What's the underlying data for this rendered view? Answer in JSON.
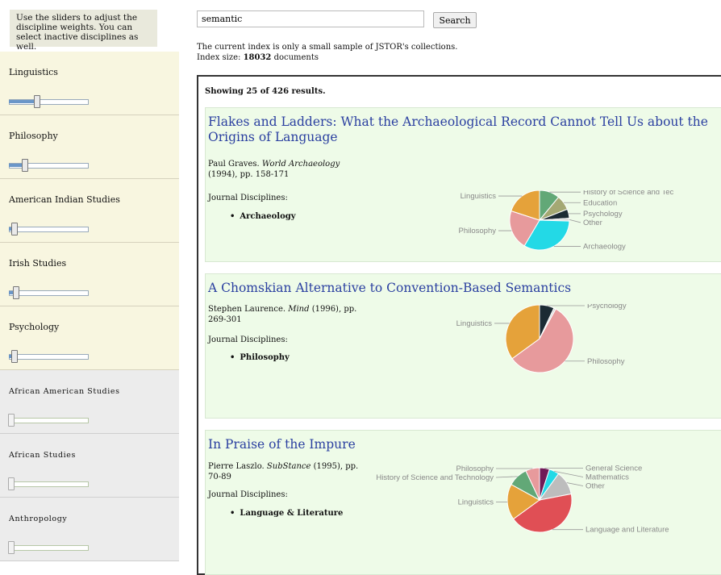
{
  "sidebar": {
    "instructions": "Use the sliders to adjust the discipline weights. You can select inactive disciplines as well.",
    "disciplines": [
      {
        "label": "Linguistics",
        "active": true,
        "weight": 0.35
      },
      {
        "label": "Philosophy",
        "active": true,
        "weight": 0.2
      },
      {
        "label": "American Indian Studies",
        "active": true,
        "weight": 0.06
      },
      {
        "label": "Irish Studies",
        "active": true,
        "weight": 0.08
      },
      {
        "label": "Psychology",
        "active": true,
        "weight": 0.06
      },
      {
        "label": "African American Studies",
        "active": false,
        "weight": 0.02
      },
      {
        "label": "African Studies",
        "active": false,
        "weight": 0.02
      },
      {
        "label": "Anthropology",
        "active": false,
        "weight": 0.02
      }
    ]
  },
  "search": {
    "value": "semantic",
    "button_label": "Search"
  },
  "notice": {
    "line1": "The current index is only a small sample of JSTOR's collections.",
    "index_prefix": "Index size: ",
    "index_size": "18032",
    "index_suffix": " documents"
  },
  "results": {
    "count_text": "Showing 25 of 426 results.",
    "discipline_header": "Journal Disciplines:",
    "colors": {
      "orange": "#e5a23a",
      "pink": "#e79a9c",
      "cyan": "#23d9e6",
      "dark": "#1c2b34",
      "olive": "#a4a873",
      "green": "#62a877",
      "light": "#d8d8d8",
      "red": "#e04f55",
      "grey": "#bdbdbd",
      "purple": "#701c57"
    },
    "items": [
      {
        "title": "Flakes and Ladders: What the Archaeological Record Cannot Tell Us about the Origins of Language",
        "author": "Paul Graves.",
        "journal": "World Archaeology",
        "citation": "(1994), pp. 158-171",
        "discipline": "Archaeology",
        "pie": [
          {
            "label": "History of Science and Technology",
            "value": 0.11,
            "color": "#62a877"
          },
          {
            "label": "Education",
            "value": 0.08,
            "color": "#a4a873"
          },
          {
            "label": "Psychology",
            "value": 0.05,
            "color": "#1c2b34"
          },
          {
            "label": "Other",
            "value": 0.015,
            "color": "#d8d8d8"
          },
          {
            "label": "Archaeology",
            "value": 0.33,
            "color": "#23d9e6"
          },
          {
            "label": "Philosophy",
            "value": 0.215,
            "color": "#e79a9c"
          },
          {
            "label": "Linguistics",
            "value": 0.2,
            "color": "#e5a23a"
          }
        ]
      },
      {
        "title": "A Chomskian Alternative to Convention-Based Semantics",
        "author": "Stephen Laurence.",
        "journal": "Mind",
        "citation": "(1996), pp. 269-301",
        "discipline": "Philosophy",
        "pie": [
          {
            "label": "Psychology",
            "value": 0.07,
            "color": "#1c2b34"
          },
          {
            "label": "",
            "value": 0.01,
            "color": "#d8d8d8"
          },
          {
            "label": "Philosophy",
            "value": 0.57,
            "color": "#e79a9c"
          },
          {
            "label": "Linguistics",
            "value": 0.35,
            "color": "#e5a23a"
          }
        ]
      },
      {
        "title": "In Praise of the Impure",
        "author": "Pierre Laszlo.",
        "journal": "SubStance",
        "citation": "(1995), pp. 70-89",
        "discipline": "Language & Literature",
        "pie": [
          {
            "label": "General Science",
            "value": 0.05,
            "color": "#701c57"
          },
          {
            "label": "Mathematics",
            "value": 0.05,
            "color": "#23d9e6"
          },
          {
            "label": "Other",
            "value": 0.12,
            "color": "#bdbdbd"
          },
          {
            "label": "Language and Literature",
            "value": 0.43,
            "color": "#e04f55"
          },
          {
            "label": "Linguistics",
            "value": 0.18,
            "color": "#e5a23a"
          },
          {
            "label": "History of Science and Technology",
            "value": 0.1,
            "color": "#62a877"
          },
          {
            "label": "Philosophy",
            "value": 0.07,
            "color": "#e79a9c"
          }
        ]
      }
    ]
  }
}
